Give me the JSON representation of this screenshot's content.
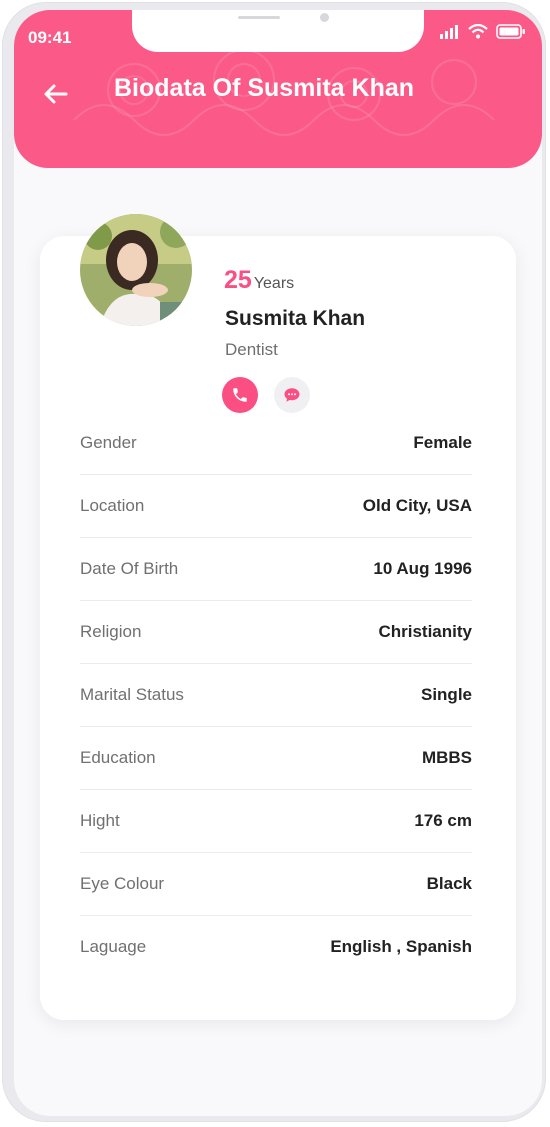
{
  "status_bar": {
    "time": "09:41"
  },
  "header": {
    "title": "Biodata Of Susmita Khan"
  },
  "profile": {
    "age": "25",
    "age_unit": "Years",
    "name": "Susmita Khan",
    "profession": "Dentist"
  },
  "details": [
    {
      "label": "Gender",
      "value": "Female"
    },
    {
      "label": "Location",
      "value": "Old City, USA"
    },
    {
      "label": "Date Of Birth",
      "value": "10 Aug 1996"
    },
    {
      "label": "Religion",
      "value": "Christianity"
    },
    {
      "label": "Marital Status",
      "value": "Single"
    },
    {
      "label": "Education",
      "value": "MBBS"
    },
    {
      "label": "Hight",
      "value": "176 cm"
    },
    {
      "label": "Eye Colour",
      "value": "Black"
    },
    {
      "label": "Laguage",
      "value": "English , Spanish"
    }
  ],
  "colors": {
    "accent": "#fb5a88",
    "background": "#f9f9fb",
    "card": "#ffffff"
  },
  "icons": [
    "back-arrow-icon",
    "signal-icon",
    "wifi-icon",
    "battery-icon",
    "phone-icon",
    "chat-icon"
  ]
}
